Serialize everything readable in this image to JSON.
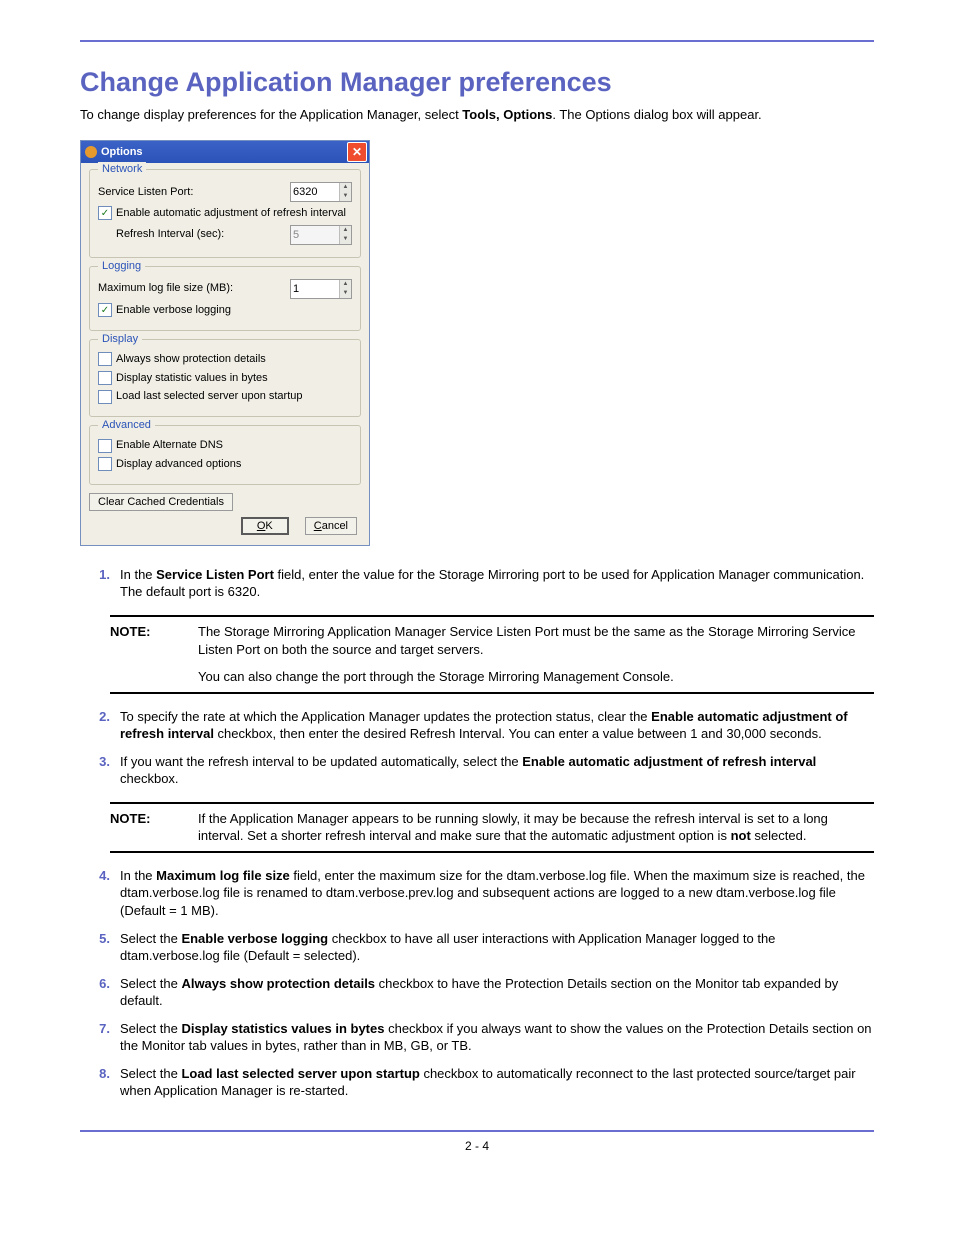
{
  "heading": "Change Application Manager preferences",
  "intro_a": "To change display preferences for the Application Manager, select ",
  "intro_b": "Tools, Options",
  "intro_c": ". The Options dialog box will appear.",
  "dialog": {
    "title": "Options",
    "network": {
      "legend": "Network",
      "listen_port_label": "Service Listen Port:",
      "listen_port_value": "6320",
      "auto_label": "Enable automatic adjustment of refresh interval",
      "refresh_label": "Refresh Interval (sec):",
      "refresh_value": "5"
    },
    "logging": {
      "legend": "Logging",
      "max_label": "Maximum log file size (MB):",
      "max_value": "1",
      "verbose_label": "Enable verbose logging"
    },
    "display": {
      "legend": "Display",
      "opt1": "Always show protection details",
      "opt2": "Display statistic values in bytes",
      "opt3": "Load last selected server upon startup"
    },
    "advanced": {
      "legend": "Advanced",
      "opt1": "Enable Alternate DNS",
      "opt2": "Display advanced options"
    },
    "clear_btn": "Clear Cached Credentials",
    "ok": "OK",
    "cancel": "Cancel"
  },
  "steps": {
    "s1a": "In the ",
    "s1b": "Service Listen Port",
    "s1c": " field, enter the value for the Storage Mirroring port to be used for Application Manager communication. The default port is 6320.",
    "note1_label": "NOTE:",
    "note1_p1": "The Storage Mirroring Application Manager Service Listen Port must be the same as the Storage Mirroring Service Listen Port on both the source and target servers.",
    "note1_p2": "You can also change the port through the Storage Mirroring Management Console.",
    "s2a": "To specify the rate at which the Application Manager updates the protection status, clear the ",
    "s2b": "Enable automatic adjustment of refresh interval",
    "s2c": " checkbox, then enter the desired Refresh Interval. You can enter a value between 1 and 30,000 seconds.",
    "s3a": "If you want the refresh interval to be updated automatically, select the ",
    "s3b": "Enable automatic adjustment of refresh interval",
    "s3c": " checkbox.",
    "note2_p1a": "If the Application Manager appears to be running slowly, it may be because the refresh interval is set to a long interval. Set a shorter refresh interval and make sure that the automatic adjustment option is ",
    "note2_p1b": "not",
    "note2_p1c": " selected.",
    "s4a": "In the ",
    "s4b": "Maximum log file size",
    "s4c": " field, enter the maximum size for the dtam.verbose.log file. When the maximum size is reached, the dtam.verbose.log file is renamed to dtam.verbose.prev.log and subsequent actions are logged to a new dtam.verbose.log file (Default = 1 MB).",
    "s5a": "Select the ",
    "s5b": "Enable verbose logging",
    "s5c": " checkbox to have all user interactions with Application Manager logged to the dtam.verbose.log file (Default = selected).",
    "s6a": "Select the ",
    "s6b": "Always show protection details",
    "s6c": " checkbox to have the Protection Details section on the Monitor tab expanded by default.",
    "s7a": "Select the ",
    "s7b": "Display statistics values in bytes",
    "s7c": " checkbox if you always want to show the values on the Protection Details section on the Monitor tab values in bytes, rather than in MB, GB, or TB.",
    "s8a": "Select the ",
    "s8b": "Load last selected server upon startup",
    "s8c": " checkbox to automatically reconnect to the last protected source/target pair when Application Manager is re-started."
  },
  "pagenum": "2 - 4"
}
